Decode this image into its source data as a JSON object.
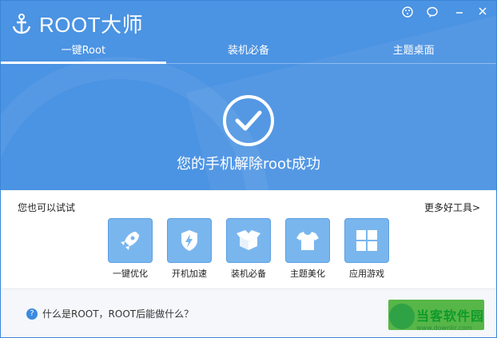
{
  "app": {
    "name": "ROOT大师"
  },
  "tabs": [
    {
      "label": "一键Root",
      "active": true
    },
    {
      "label": "装机必备",
      "active": false
    },
    {
      "label": "主题桌面",
      "active": false
    }
  ],
  "success": {
    "text": "您的手机解除root成功"
  },
  "tools_section": {
    "title": "您也可以试试",
    "more_link": "更多好工具>"
  },
  "tools": [
    {
      "label": "一键优化",
      "icon": "rocket-icon"
    },
    {
      "label": "开机加速",
      "icon": "lightning-shield-icon"
    },
    {
      "label": "装机必备",
      "icon": "package-box-icon"
    },
    {
      "label": "主题美化",
      "icon": "tshirt-icon"
    },
    {
      "label": "应用游戏",
      "icon": "app-grid-icon"
    }
  ],
  "footer": {
    "faq": "什么是ROOT，ROOT后能做什么？"
  },
  "watermark": {
    "title": "当客软件园",
    "url": "www.downkr.com"
  },
  "colors": {
    "primary": "#4b93e3",
    "tile": "#7ab6ee",
    "green": "#57b648"
  }
}
